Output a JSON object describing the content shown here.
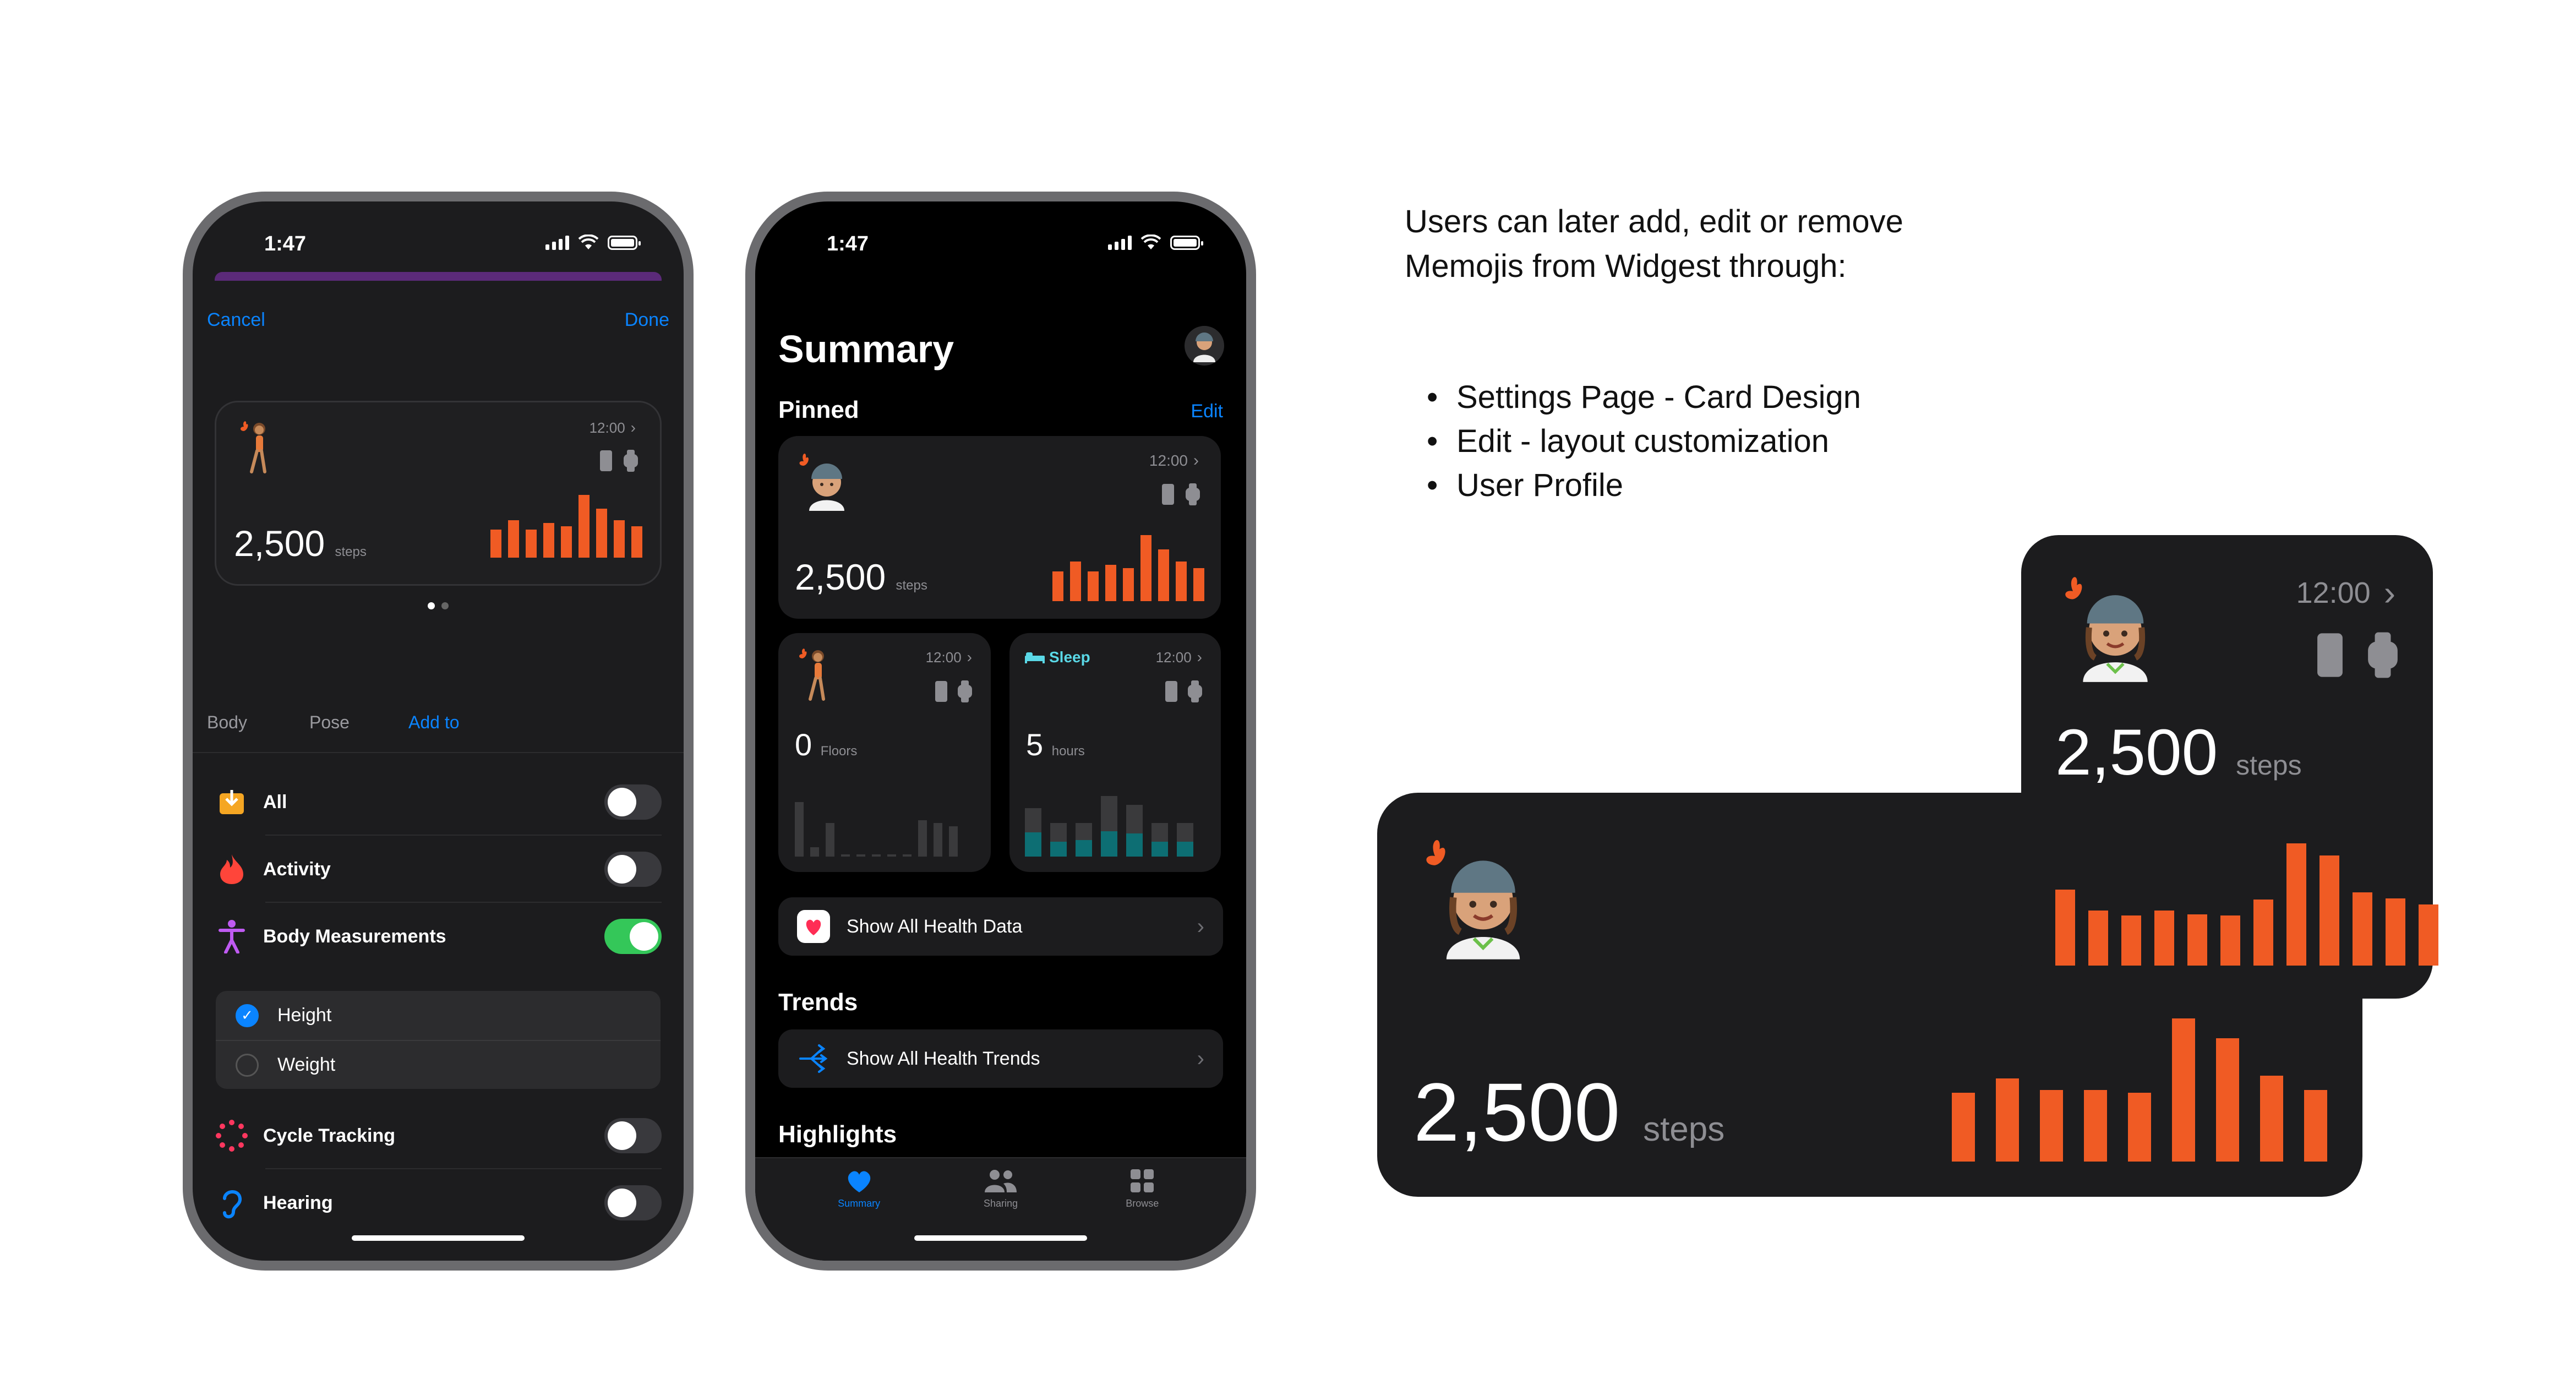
{
  "phone_settings": {
    "time": "1:47",
    "cancel": "Cancel",
    "done": "Done",
    "preview": {
      "time": "12:00",
      "value": "2,500",
      "unit": "steps",
      "bars": [
        0.45,
        0.6,
        0.45,
        0.55,
        0.5,
        1.0,
        0.78,
        0.6,
        0.5
      ]
    },
    "segments": [
      "Body",
      "Pose",
      "Add to"
    ],
    "active_segment": "Add to",
    "rows": [
      {
        "label": "All",
        "icon": "download-box-icon",
        "on": false
      },
      {
        "label": "Activity",
        "icon": "flame-icon",
        "on": false
      },
      {
        "label": "Body Measurements",
        "icon": "person-figure-icon",
        "on": true
      },
      {
        "label": "Cycle Tracking",
        "icon": "cycle-dots-icon",
        "on": false
      },
      {
        "label": "Hearing",
        "icon": "ear-icon",
        "on": false
      }
    ],
    "sub_items": [
      {
        "label": "Height",
        "checked": true
      },
      {
        "label": "Weight",
        "checked": false
      }
    ]
  },
  "phone_summary": {
    "time": "1:47",
    "title": "Summary",
    "pinned": "Pinned",
    "edit": "Edit",
    "steps_card": {
      "time": "12:00",
      "value": "2,500",
      "unit": "steps",
      "bars": [
        0.45,
        0.6,
        0.45,
        0.55,
        0.5,
        1.0,
        0.78,
        0.6,
        0.5
      ]
    },
    "floors_card": {
      "time": "12:00",
      "value": "0",
      "unit": "Floors",
      "bars": [
        0.9,
        0.15,
        0.55,
        0.02,
        0.02,
        0.02,
        0.02,
        0.02,
        0.6,
        0.55,
        0.5
      ]
    },
    "sleep_card": {
      "tag": "Sleep",
      "time": "12:00",
      "value": "5",
      "unit": "hours",
      "bars": [
        0.8,
        0.55,
        0.55,
        1.0,
        0.85,
        0.55,
        0.55
      ],
      "deep": [
        0.5,
        0.45,
        0.5,
        0.42,
        0.45,
        0.45,
        0.45
      ]
    },
    "show_all_data": "Show All Health Data",
    "trends": "Trends",
    "show_all_trends": "Show All Health Trends",
    "highlights": "Highlights",
    "tabs": [
      "Summary",
      "Sharing",
      "Browse"
    ],
    "active_tab": "Summary"
  },
  "description": {
    "intro": "Users can later add, edit or remove Memojis from Widgest through:",
    "bullets": [
      "Settings Page - Card Design",
      "Edit - layout customization",
      "User Profile"
    ]
  },
  "widget_square": {
    "time": "12:00",
    "value": "2,500",
    "unit": "steps",
    "bars": [
      0.62,
      0.45,
      0.41,
      0.45,
      0.42,
      0.41,
      0.54,
      1.0,
      0.9,
      0.6,
      0.55,
      0.5
    ]
  },
  "widget_wide": {
    "value": "2,500",
    "unit": "steps",
    "bars": [
      0.48,
      0.58,
      0.5,
      0.5,
      0.48,
      1.0,
      0.86,
      0.6,
      0.5
    ]
  },
  "colors": {
    "accent_orange": "#f05b24",
    "link_blue": "#0a84ff",
    "toggle_green": "#34c759",
    "card_bg": "#1c1c1e"
  }
}
